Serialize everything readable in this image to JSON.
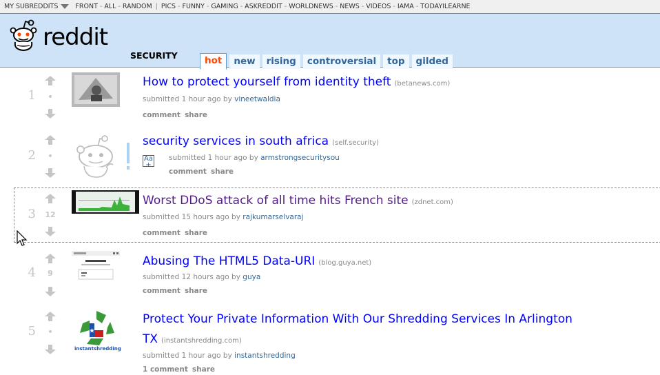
{
  "srbar": {
    "my_subreddits": "MY SUBREDDITS",
    "group1": [
      "FRONT",
      "ALL",
      "RANDOM"
    ],
    "group2": [
      "PICS",
      "FUNNY",
      "GAMING",
      "ASKREDDIT",
      "WORLDNEWS",
      "NEWS",
      "VIDEOS",
      "IAMA",
      "TODAYILEARNE"
    ]
  },
  "header": {
    "wordmark": "reddit",
    "pagename": "SECURITY",
    "tabs": [
      "hot",
      "new",
      "rising",
      "controversial",
      "top",
      "gilded"
    ],
    "selected_tab": "hot"
  },
  "posts": [
    {
      "rank": "1",
      "score": "•",
      "title": "How to protect yourself from identity theft",
      "domain": "(betanews.com)",
      "tagline_prefix": "submitted 1 hour ago by ",
      "author": "vineetwaldia",
      "comments": "comment",
      "share": "share"
    },
    {
      "rank": "2",
      "score": "•",
      "title": "security services in south africa",
      "domain": "(self.security)",
      "tagline_prefix": "submitted 1 hour ago by ",
      "author": "armstrongsecuritysou",
      "comments": "comment",
      "share": "share",
      "expando_label": "Aa"
    },
    {
      "rank": "3",
      "score": "12",
      "title": "Worst DDoS attack of all time hits French site",
      "domain": "(zdnet.com)",
      "tagline_prefix": "submitted 15 hours ago by ",
      "author": "rajkumarselvaraj",
      "comments": "comment",
      "share": "share"
    },
    {
      "rank": "4",
      "score": "9",
      "title": "Abusing The HTML5 Data-URI",
      "domain": "(blog.guya.net)",
      "tagline_prefix": "submitted 12 hours ago by ",
      "author": "guya",
      "comments": "comment",
      "share": "share"
    },
    {
      "rank": "5",
      "score": "•",
      "title_line1": "Protect Your Private Information With Our Shredding Services In Arlington",
      "title_line2": "TX",
      "domain": "(instantshredding.com)",
      "tagline_prefix": "submitted 1 hour ago by ",
      "author": "instantshredding",
      "comments": "1 comment",
      "share": "share",
      "thumb_text": "instantshredding"
    }
  ],
  "colors": {
    "link": "#0000ff",
    "visited": "#551a8b",
    "header_bg": "#cee3f8",
    "selected_tab": "#ff4500"
  }
}
